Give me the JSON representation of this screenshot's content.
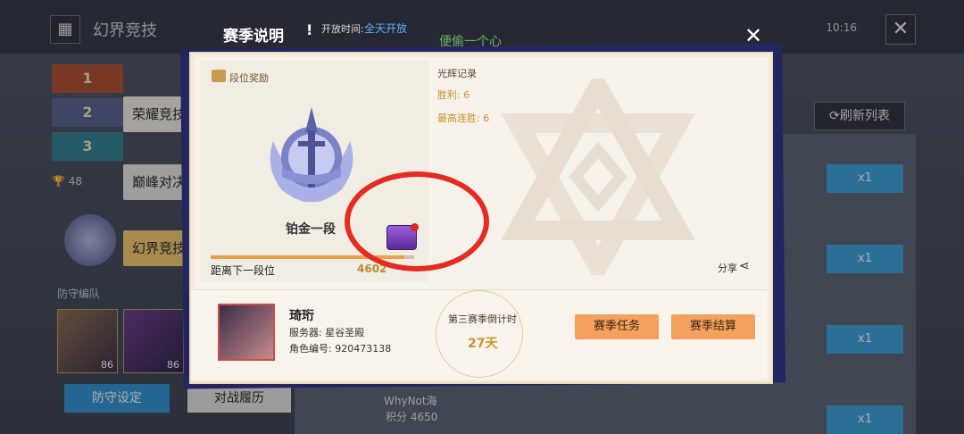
{
  "background": {
    "app_title": "幻界竞技",
    "menu_icon": "grid-icon",
    "status_time": "10:16",
    "close_icon": "close-icon",
    "rank_badges": [
      "1",
      "2",
      "3"
    ],
    "side_tabs": [
      "荣耀竞技",
      "巅峰对决",
      "幻界竞技"
    ],
    "trophy_count": "48",
    "defense_section": "防守编队",
    "hero_levels": [
      "86",
      "86"
    ],
    "defense_setting_btn": "防守设定",
    "battle_history_btn": "对战履历",
    "refresh_btn": "刷新列表",
    "ticket_label": "x1",
    "bottom_player_name": "WhyNot海",
    "bottom_player_score": "积分 4650",
    "bg_text_green": "便偷一个心"
  },
  "modal": {
    "title": "赛季说明",
    "info_mark": "!",
    "open_time_label": "开放时间:",
    "open_time_value": "全天开放",
    "close_icon": "close-icon",
    "rank_reward_label": "段位奖励",
    "tier_name": "铂金一段",
    "next_tier_label": "距离下一段位",
    "next_tier_value": "4602",
    "progress_fraction": 0.95,
    "record_title": "光辉记录",
    "wins": "胜利: 6",
    "max_streak": "最高连胜: 6",
    "share_label": "分享",
    "player_name": "琦珩",
    "server": "服务器: 星谷圣殿",
    "role_id": "角色编号: 920473138",
    "countdown_label": "第三赛季倒计时",
    "countdown_value": "27天",
    "season_task_btn": "赛季任务",
    "season_settle_btn": "赛季结算"
  },
  "colors": {
    "accent_orange": "#f2a15e",
    "highlight_ring": "#e52b22",
    "link_blue": "#5fb1ff",
    "gold_text": "#c8932b"
  }
}
